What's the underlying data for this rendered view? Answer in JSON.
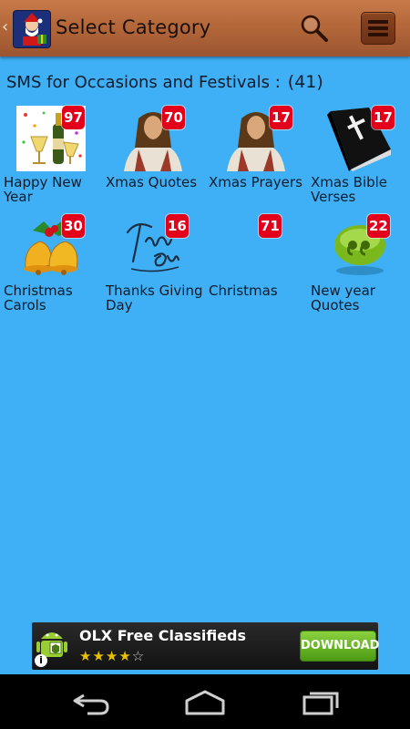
{
  "header": {
    "title": "Select Category"
  },
  "section": {
    "title": "SMS for Occasions and Festivals :",
    "count": "(41)"
  },
  "categories": [
    {
      "label": "Happy New Year",
      "count": "97",
      "icon": "new-year-champagne"
    },
    {
      "label": "Xmas Quotes",
      "count": "70",
      "icon": "jesus-portrait"
    },
    {
      "label": "Xmas Prayers",
      "count": "17",
      "icon": "jesus-portrait"
    },
    {
      "label": "Xmas Bible Verses",
      "count": "17",
      "icon": "bible-book"
    },
    {
      "label": "Christmas Carols",
      "count": "30",
      "icon": "christmas-bells"
    },
    {
      "label": "Thanks Giving Day",
      "count": "16",
      "icon": "thank-you-script"
    },
    {
      "label": "Christmas",
      "count": "71",
      "icon": "none"
    },
    {
      "label": "New year Quotes",
      "count": "22",
      "icon": "green-quote-bubble"
    }
  ],
  "ad": {
    "title": "OLX Free Classifieds",
    "rating": 4,
    "button": "DOWNLOAD",
    "info": "i",
    "stars_filled": "★★★★",
    "stars_empty": "☆"
  },
  "colors": {
    "background": "#3fb0f5",
    "actionbar": "#b4683a",
    "badge": "#e2001a"
  }
}
